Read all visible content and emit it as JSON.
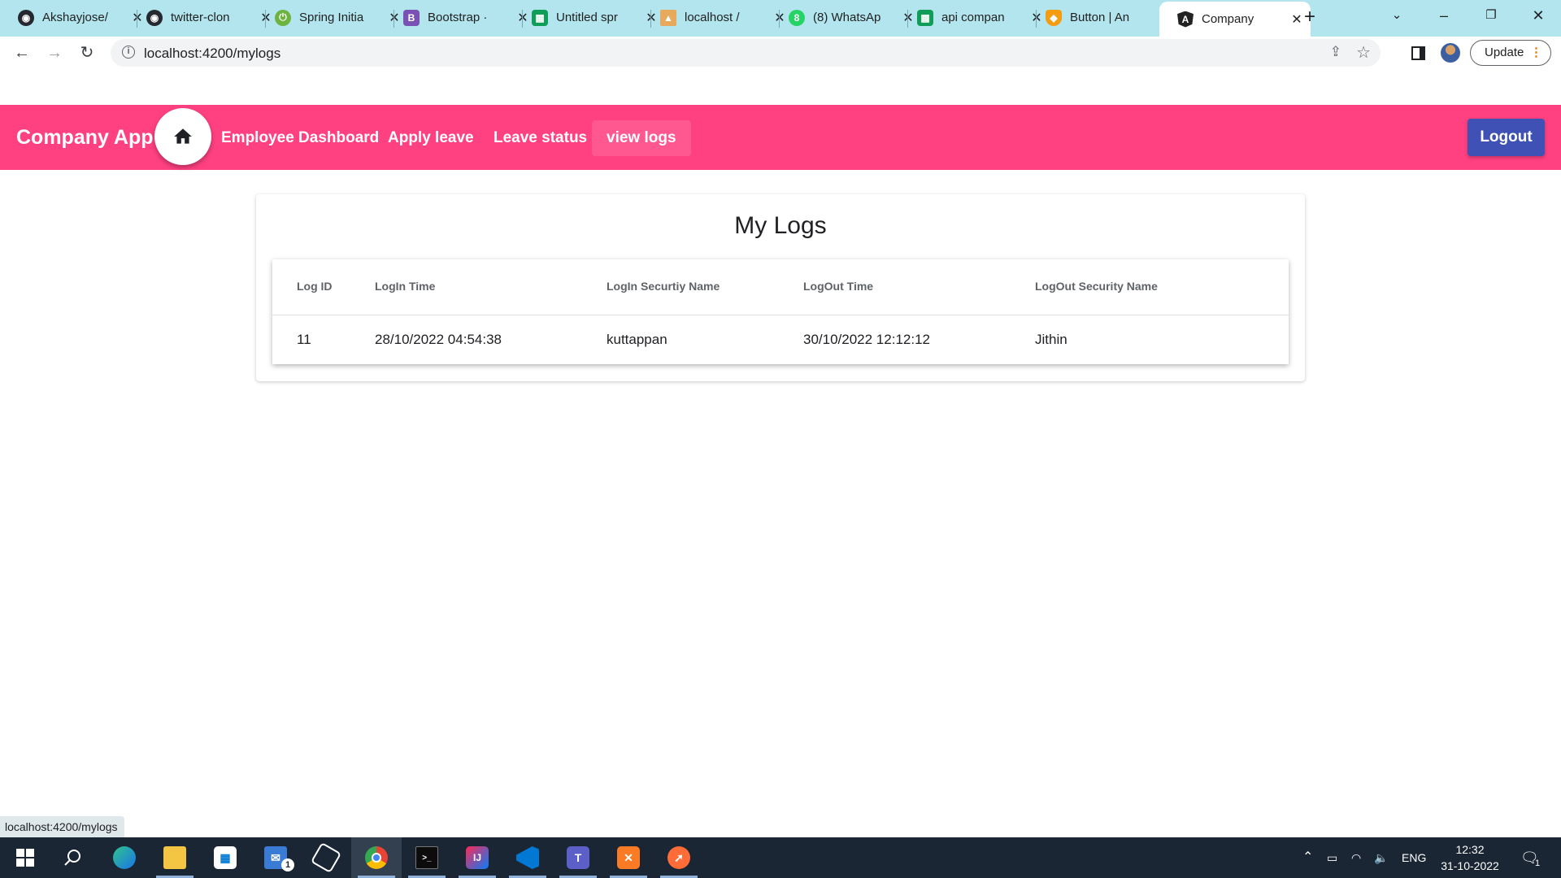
{
  "browser": {
    "tabs": [
      {
        "title": "Akshayjose/",
        "icon": "github-icon"
      },
      {
        "title": "twitter-clon",
        "icon": "github-icon"
      },
      {
        "title": "Spring Initia",
        "icon": "spring-icon"
      },
      {
        "title": "Bootstrap ·",
        "icon": "bootstrap-icon"
      },
      {
        "title": "Untitled spr",
        "icon": "sheets-icon"
      },
      {
        "title": "localhost /",
        "icon": "phpmyadmin-icon"
      },
      {
        "title": "(8) WhatsAp",
        "icon": "whatsapp-icon"
      },
      {
        "title": "api compan",
        "icon": "sheets-icon"
      },
      {
        "title": "Button | An",
        "icon": "angular-material-icon"
      },
      {
        "title": "Company",
        "icon": "angular-icon"
      }
    ],
    "url": "localhost:4200/mylogs",
    "update_label": "Update",
    "status_url": "localhost:4200/mylogs"
  },
  "app": {
    "brand": "Company App .",
    "nav": [
      {
        "label": "Employee Dashboard"
      },
      {
        "label": "Apply leave"
      },
      {
        "label": "Leave status"
      },
      {
        "label": "view logs"
      }
    ],
    "logout_label": "Logout"
  },
  "logs": {
    "title": "My Logs",
    "columns": [
      "Log ID",
      "LogIn Time",
      "LogIn Securtiy Name",
      "LogOut Time",
      "LogOut Security Name"
    ],
    "rows": [
      [
        "11",
        "28/10/2022 04:54:38",
        "kuttappan",
        "30/10/2022 12:12:12",
        "Jithin"
      ]
    ]
  },
  "taskbar": {
    "language": "ENG",
    "time": "12:32",
    "date": "31-10-2022",
    "mail_badge": "1",
    "notification_badge": "1"
  },
  "colors": {
    "toolbar_primary": "#ff4081",
    "logout_button": "#3f51b5",
    "tabstrip": "#b3e5ef"
  }
}
